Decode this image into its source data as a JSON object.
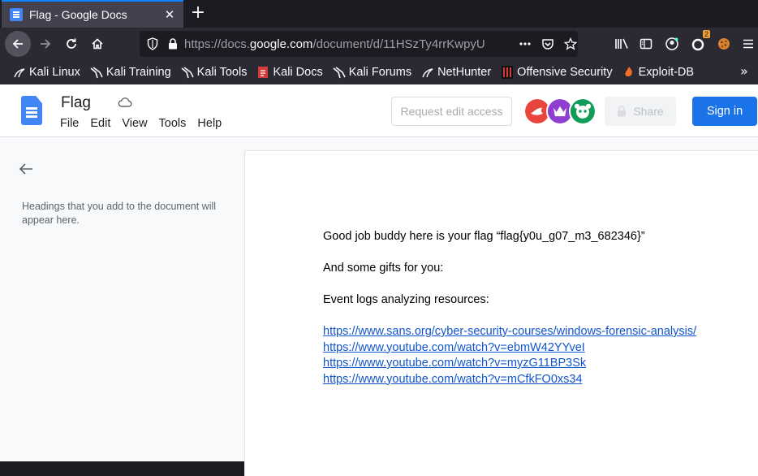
{
  "browser": {
    "tab": {
      "title": "Flag - Google Docs",
      "close_glyph": "✕"
    },
    "newtab_glyph": "+",
    "url": {
      "host_prefix": "https://docs.",
      "host": "google.com",
      "path": "/document/d/11HSzTy4rrKwpyU"
    },
    "extension_badge": "2",
    "bookmarks": [
      {
        "label": "Kali Linux",
        "icon": "kali-dragon-icon"
      },
      {
        "label": "Kali Training",
        "icon": "kali-dragon-icon"
      },
      {
        "label": "Kali Tools",
        "icon": "kali-dragon-icon"
      },
      {
        "label": "Kali Docs",
        "icon": "kali-docs-icon"
      },
      {
        "label": "Kali Forums",
        "icon": "kali-dragon-icon"
      },
      {
        "label": "NetHunter",
        "icon": "nethunter-icon"
      },
      {
        "label": "Offensive Security",
        "icon": "offsec-icon"
      },
      {
        "label": "Exploit-DB",
        "icon": "exploitdb-icon"
      }
    ],
    "bookmarks_more": "»"
  },
  "docs": {
    "title": "Flag",
    "menu": [
      "File",
      "Edit",
      "View",
      "Tools",
      "Help"
    ],
    "request_edit": "Request edit access",
    "share": "Share",
    "sign_in": "Sign in",
    "outline_hint": "Headings that you add to the document will appear here."
  },
  "document": {
    "line1": "Good job buddy here is your flag “flag{y0u_g07_m3_682346}”",
    "line2": "And some gifts for you:",
    "line3": "Event logs analyzing resources:",
    "links": [
      "https://www.sans.org/cyber-security-courses/windows-forensic-analysis/",
      "https://www.youtube.com/watch?v=ebmW42YYveI",
      "https://www.youtube.com/watch?v=myzG11BP3Sk",
      "https://www.youtube.com/watch?v=mCfkFO0xs34"
    ]
  },
  "colors": {
    "browser_chrome": "#2b2a33",
    "tab_active": "#42414d",
    "docs_blue": "#4285f4",
    "signin_blue": "#1a73e8",
    "link": "#1155cc"
  }
}
